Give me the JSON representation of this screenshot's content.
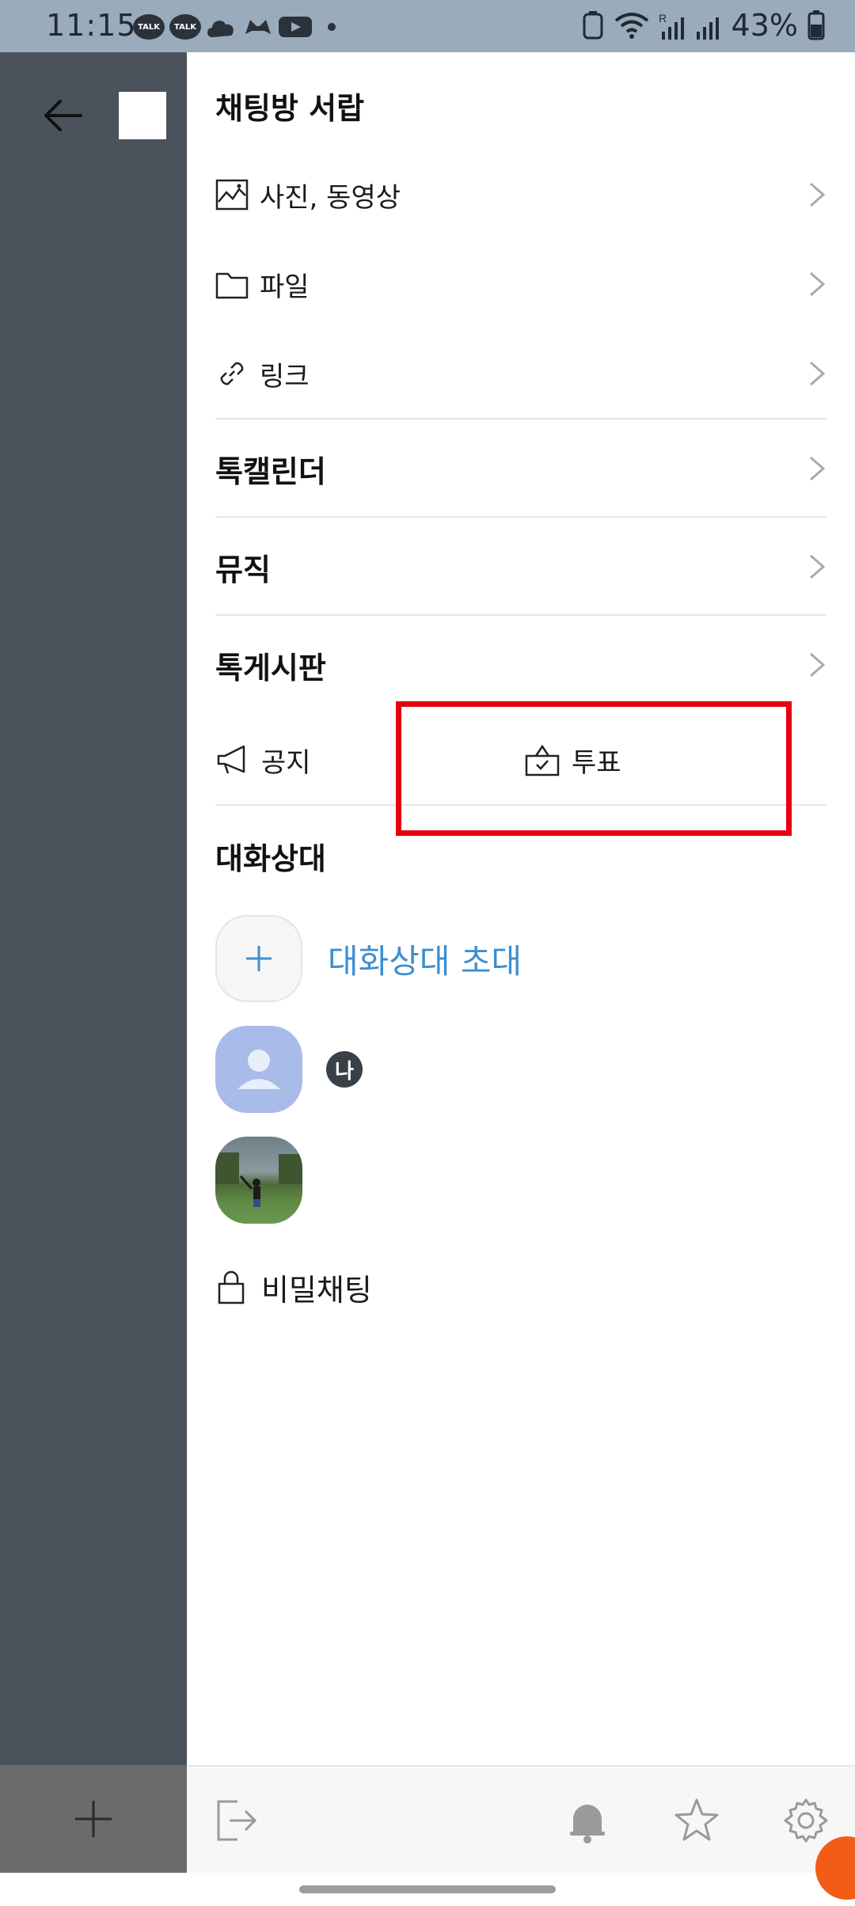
{
  "status": {
    "time": "11:15",
    "battery": "43%",
    "talk_label": "TALK",
    "roaming": "R"
  },
  "drawer": {
    "title": "채팅방 서랍",
    "items": [
      {
        "label": "사진, 동영상",
        "icon": "image-icon"
      },
      {
        "label": "파일",
        "icon": "folder-icon"
      },
      {
        "label": "링크",
        "icon": "link-icon"
      }
    ],
    "sections": [
      {
        "label": "톡캘린더"
      },
      {
        "label": "뮤직"
      },
      {
        "label": "톡게시판"
      }
    ],
    "notice_label": "공지",
    "vote_label": "투표"
  },
  "members": {
    "title": "대화상대",
    "invite_label": "대화상대 초대",
    "me_badge": "나"
  },
  "secret_chat_label": "비밀채팅",
  "colors": {
    "accent_blue": "#3d8fd1",
    "highlight_red": "#e60012",
    "side_panel": "#4a535c"
  }
}
